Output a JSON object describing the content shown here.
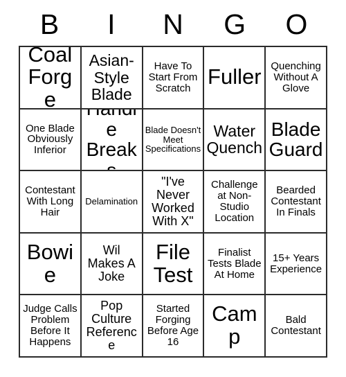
{
  "card": {
    "title": "BINGO",
    "header_letters": [
      "B",
      "I",
      "N",
      "G",
      "O"
    ],
    "columns": 5,
    "rows": 5,
    "colors": {
      "background": "#ffffff",
      "border": "#2b2b2b",
      "text": "#000000"
    },
    "cells": [
      {
        "text": "Coal Forge",
        "size": "fs-xxl"
      },
      {
        "text": "Asian-Style Blade",
        "size": "fs-l"
      },
      {
        "text": "Have To Start From Scratch",
        "size": "fs-s"
      },
      {
        "text": "Fuller",
        "size": "fs-xxl"
      },
      {
        "text": "Quenching Without A Glove",
        "size": "fs-s"
      },
      {
        "text": "One Blade Obviously Inferior",
        "size": "fs-s"
      },
      {
        "text": "Handle Breaks",
        "size": "fs-xl"
      },
      {
        "text": "Blade Doesn't Meet Specifications",
        "size": "fs-xs"
      },
      {
        "text": "Water Quench",
        "size": "fs-l"
      },
      {
        "text": "Blade Guard",
        "size": "fs-xl"
      },
      {
        "text": "Contestant With Long Hair",
        "size": "fs-s"
      },
      {
        "text": "Delamination",
        "size": "fs-xs"
      },
      {
        "text": "\"I've Never Worked With X\"",
        "size": "fs-m"
      },
      {
        "text": "Challenge at Non-Studio Location",
        "size": "fs-s"
      },
      {
        "text": "Bearded Contestant In Finals",
        "size": "fs-s"
      },
      {
        "text": "Bowie",
        "size": "fs-xxl"
      },
      {
        "text": "Wil Makes A Joke",
        "size": "fs-m"
      },
      {
        "text": "File Test",
        "size": "fs-xxl"
      },
      {
        "text": "Finalist Tests Blade At Home",
        "size": "fs-s"
      },
      {
        "text": "15+ Years Experience",
        "size": "fs-s"
      },
      {
        "text": "Judge Calls Problem Before It Happens",
        "size": "fs-s"
      },
      {
        "text": "Pop Culture Reference",
        "size": "fs-m"
      },
      {
        "text": "Started Forging Before Age 16",
        "size": "fs-s"
      },
      {
        "text": "Camp",
        "size": "fs-xxl"
      },
      {
        "text": "Bald Contestant",
        "size": "fs-s"
      }
    ]
  }
}
